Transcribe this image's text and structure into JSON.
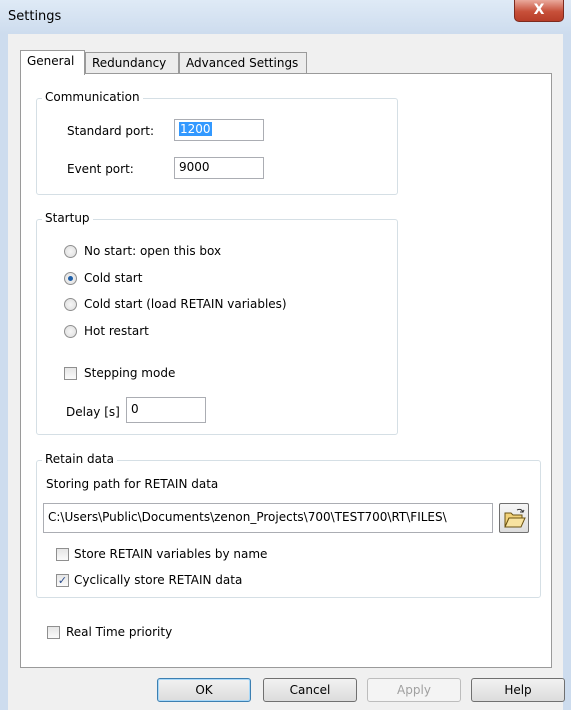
{
  "window": {
    "title": "Settings",
    "close_label": "X"
  },
  "tabs": [
    {
      "label": "General",
      "active": true
    },
    {
      "label": "Redundancy",
      "active": false
    },
    {
      "label": "Advanced Settings",
      "active": false
    }
  ],
  "communication": {
    "legend": "Communication",
    "standard_port_label": "Standard port:",
    "standard_port_value": "1200",
    "event_port_label": "Event port:",
    "event_port_value": "9000"
  },
  "startup": {
    "legend": "Startup",
    "options": [
      {
        "label": "No start: open this box",
        "selected": false
      },
      {
        "label": "Cold  start",
        "selected": true
      },
      {
        "label": "Cold start (load RETAIN variables)",
        "selected": false
      },
      {
        "label": "Hot restart",
        "selected": false
      }
    ],
    "stepping_mode_label": "Stepping mode",
    "stepping_mode_checked": false,
    "delay_label": "Delay [s]",
    "delay_value": "0"
  },
  "retain": {
    "legend": "Retain data",
    "path_label": "Storing path for RETAIN data",
    "path_value": "C:\\Users\\Public\\Documents\\zenon_Projects\\700\\TEST700\\RT\\FILES\\",
    "browse_icon": "folder-open-icon",
    "store_by_name_label": "Store RETAIN variables by name",
    "store_by_name_checked": false,
    "cyclic_label": "Cyclically store RETAIN data",
    "cyclic_checked": true
  },
  "realtime": {
    "label": "Real Time priority",
    "checked": false
  },
  "buttons": {
    "ok": "OK",
    "cancel": "Cancel",
    "apply": "Apply",
    "help": "Help"
  }
}
